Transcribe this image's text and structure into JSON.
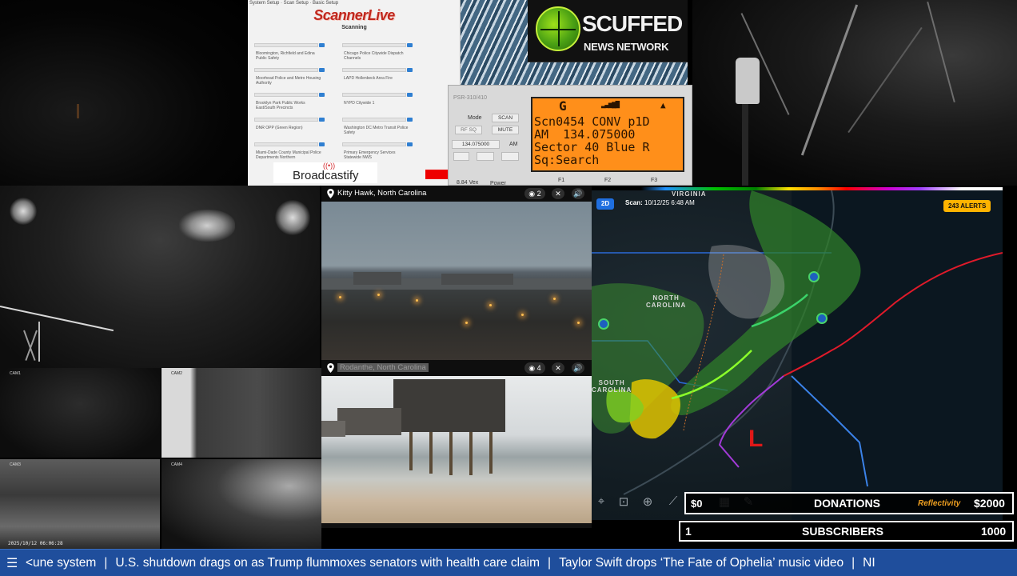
{
  "scanner_app": {
    "menu": "System Setup · Scan Setup · Basic Setup",
    "logo": "ScannerLive",
    "status": "Scanning",
    "systems_col1": [
      "Bloomington, Richfield and Edina Public Safety",
      "Moorhead Police and Metro Housing Authority",
      "Brooklyn Park Public Works East/South Precincts",
      "DNR OPP (Green Region)",
      "Miami-Dade County Municipal Police Departments Northern"
    ],
    "systems_col2": [
      "Chicago Police Citywide Dispatch Channels",
      "LAPD Hollenbeck Area Fire",
      "NYPD Citywide 1",
      "Washington DC Metro Transit Police Safety",
      "Primary Emergency Services Statewide NWS"
    ],
    "broadcastify_label": "Broadcastify"
  },
  "scanner_radio": {
    "model": "PSR-310/410",
    "mode_label": "Mode",
    "scan_label": "SCAN",
    "mute_label": "MUTE",
    "rfsq_label": "RF SQ",
    "freq_field": "134.075000",
    "am_label": "AM",
    "power_label": "Power",
    "voltage": "8.84 Vex",
    "lcd": {
      "row0": "G",
      "row1": "Scn0454 CONV p1D",
      "row2": "AM  134.075000",
      "row3": "Sector 40 Blue R",
      "row4": "Sq:Search"
    },
    "fkeys": [
      "F1",
      "F2",
      "F3"
    ]
  },
  "scuffed_logo": {
    "line1": "SCUFFED",
    "line2": "NEWS NETWORK"
  },
  "cams": {
    "grid_labels": [
      "CAM1",
      "CAM2",
      "CAM3",
      "CAM4"
    ],
    "timestamp": "2025/10/12 06:06:28"
  },
  "video_top": {
    "location": "Kitty Hawk, North Carolina",
    "views": "2"
  },
  "video_bottom": {
    "location": "Rodanthe, North Carolina",
    "views": "4"
  },
  "radar": {
    "mode_badge": "2D",
    "scan_label": "Scan:",
    "scan_time": "10/12/25 6:48 AM",
    "alerts": "243 ALERTS",
    "states": [
      "VIRGINIA",
      "NORTH\nCAROLINA",
      "SOUTH\nCAROLINA"
    ],
    "low_marker": "L"
  },
  "donations": {
    "current": "$0",
    "label": "DONATIONS",
    "sponsor": "Reflectivity",
    "goal": "$2000"
  },
  "subscribers": {
    "current": "1",
    "label": "SUBSCRIBERS",
    "goal": "1000"
  },
  "ticker": {
    "headlines": [
      "<une system",
      "U.S. shutdown drags on as Trump flummoxes senators with health care claim",
      "Taylor Swift drops ‘The Fate of Ophelia’ music video",
      "NI"
    ]
  },
  "colors": {
    "ticker_bg": "#1f4e9c",
    "lcd_bg": "#ff8f1a",
    "alert_badge": "#ffb300",
    "storm_low": "#e01818"
  }
}
